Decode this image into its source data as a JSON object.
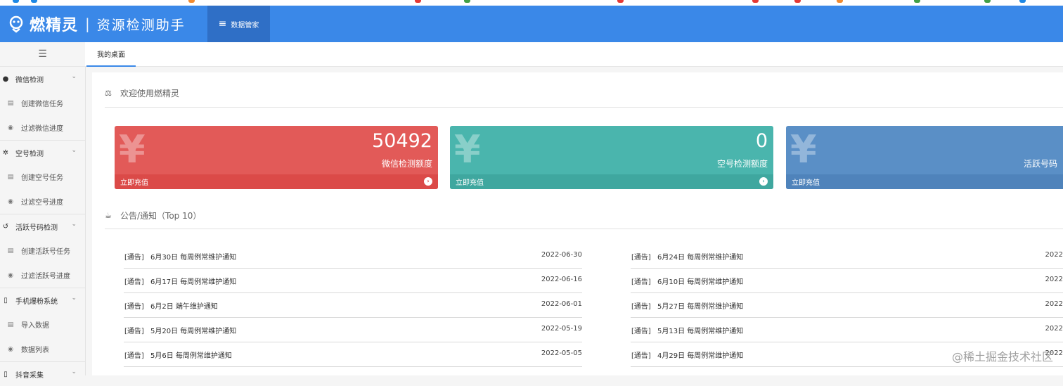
{
  "app": {
    "brand": "燃精灵",
    "separator": "|",
    "subtitle": "资源检测助手",
    "nav_button": "数据管家"
  },
  "colors": {
    "header": "#3a88e8",
    "card_red": "#e25a58",
    "card_teal": "#4ab5ad",
    "card_blue": "#5a8fc6"
  },
  "sidebar": {
    "toggle_icon": "indent-icon",
    "groups": [
      {
        "label": "微信检测",
        "icon": "chat-icon",
        "items": [
          {
            "label": "创建微信任务",
            "icon": "doc-icon"
          },
          {
            "label": "过滤微信进度",
            "icon": "eye-icon"
          }
        ]
      },
      {
        "label": "空号检测",
        "icon": "gear-icon",
        "items": [
          {
            "label": "创建空号任务",
            "icon": "doc-icon"
          },
          {
            "label": "过滤空号进度",
            "icon": "eye-icon"
          }
        ]
      },
      {
        "label": "活跃号码检测",
        "icon": "history-icon",
        "items": [
          {
            "label": "创建活跃号任务",
            "icon": "doc-icon"
          },
          {
            "label": "过滤活跃号进度",
            "icon": "eye-icon"
          }
        ]
      },
      {
        "label": "手机爆粉系统",
        "icon": "phone-icon",
        "items": [
          {
            "label": "导入数据",
            "icon": "doc-icon"
          },
          {
            "label": "数据列表",
            "icon": "eye-icon"
          }
        ]
      },
      {
        "label": "抖音采集",
        "icon": "phone-icon",
        "items": []
      }
    ]
  },
  "tabs": [
    {
      "label": "我的桌面"
    }
  ],
  "welcome": {
    "title": "欢迎使用燃精灵",
    "icon": "balance-icon"
  },
  "cards": [
    {
      "symbol": "¥",
      "value": "50492",
      "label": "微信检测额度",
      "footer": "立即充值"
    },
    {
      "symbol": "¥",
      "value": "0",
      "label": "空号检测额度",
      "footer": "立即充值"
    },
    {
      "symbol": "¥",
      "value": "",
      "label": "活跃号码",
      "footer": "立即充值"
    }
  ],
  "notices": {
    "title": "公告/通知（Top 10）",
    "icon": "coffee-icon",
    "left": [
      {
        "tag": "[通告]",
        "title": "6月30日 每周例常维护通知",
        "date": "2022-06-30"
      },
      {
        "tag": "[通告]",
        "title": "6月17日 每周例常维护通知",
        "date": "2022-06-16"
      },
      {
        "tag": "[通告]",
        "title": "6月2日 端午维护通知",
        "date": "2022-06-01"
      },
      {
        "tag": "[通告]",
        "title": "5月20日 每周例常维护通知",
        "date": "2022-05-19"
      },
      {
        "tag": "[通告]",
        "title": "5月6日 每周例常维护通知",
        "date": "2022-05-05"
      }
    ],
    "right": [
      {
        "tag": "[通告]",
        "title": "6月24日 每周例常维护通知",
        "date": "2022"
      },
      {
        "tag": "[通告]",
        "title": "6月10日 每周例常维护通知",
        "date": "2022"
      },
      {
        "tag": "[通告]",
        "title": "5月27日 每周例常维护通知",
        "date": "2022"
      },
      {
        "tag": "[通告]",
        "title": "5月13日 每周例常维护通知",
        "date": "2022"
      },
      {
        "tag": "[通告]",
        "title": "4月29日 每周例常维护通知",
        "date": "2022"
      }
    ]
  },
  "watermark": "@稀土掘金技术社区"
}
